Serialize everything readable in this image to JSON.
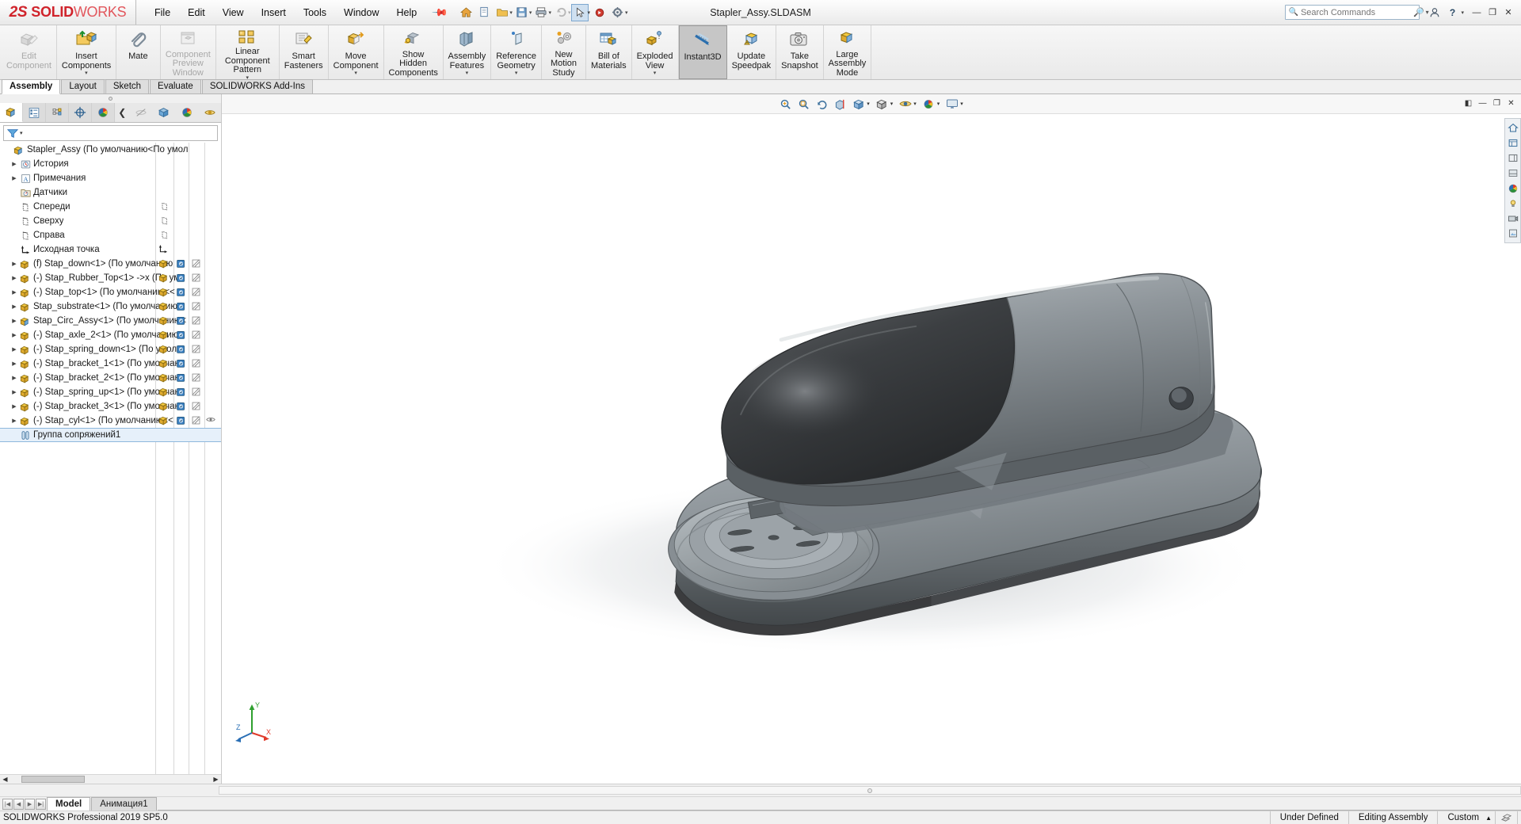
{
  "window": {
    "document_title": "Stapler_Assy.SLDASM",
    "logo_ds": "2S",
    "logo_solid": "SOLID",
    "logo_works": "WORKS"
  },
  "menu": {
    "items": [
      "File",
      "Edit",
      "View",
      "Insert",
      "Tools",
      "Window",
      "Help"
    ],
    "pin_icon": "pin-icon"
  },
  "title_toolbar": {
    "icons": [
      "home-icon",
      "new-doc-icon",
      "open-folder-icon",
      "save-icon",
      "print-icon",
      "undo-icon",
      "select-arrow-icon",
      "rebuild-icon",
      "options-gear-icon"
    ],
    "search": {
      "placeholder": "Search Commands",
      "value": ""
    },
    "user_icon": "user-icon",
    "help_icon": "help-icon",
    "minimize": "minimize-icon",
    "maximize": "maximize-icon",
    "close": "close-icon"
  },
  "ribbon": {
    "commands": [
      {
        "label": "Edit\nComponent",
        "icon": "edit-component-icon",
        "disabled": true,
        "caret": false,
        "active": false
      },
      {
        "label": "Insert\nComponents",
        "icon": "insert-components-icon",
        "disabled": false,
        "caret": true,
        "active": false
      },
      {
        "label": "Mate",
        "icon": "mate-paperclip-icon",
        "disabled": false,
        "caret": false,
        "active": false
      },
      {
        "label": "Component\nPreview\nWindow",
        "icon": "component-preview-icon",
        "disabled": true,
        "caret": false,
        "active": false
      },
      {
        "label": "Linear Component\nPattern",
        "icon": "linear-pattern-icon",
        "disabled": false,
        "caret": true,
        "active": false
      },
      {
        "label": "Smart\nFasteners",
        "icon": "smart-fasteners-icon",
        "disabled": false,
        "caret": false,
        "active": false
      },
      {
        "label": "Move\nComponent",
        "icon": "move-component-icon",
        "disabled": false,
        "caret": true,
        "active": false
      },
      {
        "label": "Show\nHidden\nComponents",
        "icon": "show-hidden-icon",
        "disabled": false,
        "caret": false,
        "active": false
      },
      {
        "label": "Assembly\nFeatures",
        "icon": "assembly-features-icon",
        "disabled": false,
        "caret": true,
        "active": false
      },
      {
        "label": "Reference\nGeometry",
        "icon": "reference-geometry-icon",
        "disabled": false,
        "caret": true,
        "active": false
      },
      {
        "label": "New\nMotion\nStudy",
        "icon": "new-motion-study-icon",
        "disabled": false,
        "caret": false,
        "active": false
      },
      {
        "label": "Bill of\nMaterials",
        "icon": "bill-of-materials-icon",
        "disabled": false,
        "caret": false,
        "active": false
      },
      {
        "label": "Exploded\nView",
        "icon": "exploded-view-icon",
        "disabled": false,
        "caret": true,
        "active": false
      },
      {
        "label": "Instant3D",
        "icon": "instant3d-icon",
        "disabled": false,
        "caret": false,
        "active": true
      },
      {
        "label": "Update\nSpeedpak",
        "icon": "update-speedpak-icon",
        "disabled": false,
        "caret": false,
        "active": false
      },
      {
        "label": "Take\nSnapshot",
        "icon": "take-snapshot-icon",
        "disabled": false,
        "caret": false,
        "active": false
      },
      {
        "label": "Large\nAssembly\nMode",
        "icon": "large-assembly-mode-icon",
        "disabled": false,
        "caret": false,
        "active": false
      }
    ]
  },
  "ribbon_tabs": {
    "items": [
      "Assembly",
      "Layout",
      "Sketch",
      "Evaluate",
      "SOLIDWORKS Add-Ins"
    ],
    "selected": "Assembly"
  },
  "feature_manager": {
    "tabs": [
      "feature-tree-icon",
      "property-manager-icon",
      "configuration-manager-icon",
      "dimxpert-icon",
      "display-manager-icon"
    ],
    "selected_index": 0,
    "collapse_icon": "chevron-left-icon",
    "extra_icons": [
      "hide-show-icon",
      "view-cube-icon",
      "appearance-sphere-icon",
      "display-pane-icon"
    ],
    "filter_placeholder": "",
    "filter_icon": "filter-funnel-icon",
    "tree": [
      {
        "label": "Stapler_Assy  (По умолчанию<По умол",
        "icon": "assembly-icon",
        "indent": 0,
        "expand": false,
        "root": true
      },
      {
        "label": "История",
        "icon": "history-icon",
        "indent": 1,
        "expand": true
      },
      {
        "label": "Примечания",
        "icon": "annotations-icon",
        "indent": 1,
        "expand": true
      },
      {
        "label": "Датчики",
        "icon": "sensors-icon",
        "indent": 1,
        "expand": false
      },
      {
        "label": "Спереди",
        "icon": "plane-icon",
        "indent": 1,
        "expand": false
      },
      {
        "label": "Сверху",
        "icon": "plane-icon",
        "indent": 1,
        "expand": false
      },
      {
        "label": "Справа",
        "icon": "plane-icon",
        "indent": 1,
        "expand": false
      },
      {
        "label": "Исходная точка",
        "icon": "origin-icon",
        "indent": 1,
        "expand": false
      },
      {
        "label": "(f) Stap_down<1> (По умолчанию",
        "icon": "part-icon",
        "indent": 1,
        "expand": true,
        "comp": true
      },
      {
        "label": "(-) Stap_Rubber_Top<1> ->x (По ум",
        "icon": "part-icon",
        "indent": 1,
        "expand": true,
        "comp": true
      },
      {
        "label": "(-) Stap_top<1> (По умолчанию<<",
        "icon": "part-icon",
        "indent": 1,
        "expand": true,
        "comp": true
      },
      {
        "label": "Stap_substrate<1> (По умолчанию<",
        "icon": "part-icon",
        "indent": 1,
        "expand": true,
        "comp": true
      },
      {
        "label": "Stap_Circ_Assy<1> (По умолчанию<",
        "icon": "subassembly-icon",
        "indent": 1,
        "expand": true,
        "comp": true
      },
      {
        "label": "(-) Stap_axle_2<1> (По умолчанию",
        "icon": "part-icon",
        "indent": 1,
        "expand": true,
        "comp": true
      },
      {
        "label": "(-) Stap_spring_down<1> (По умол",
        "icon": "part-icon",
        "indent": 1,
        "expand": true,
        "comp": true
      },
      {
        "label": "(-) Stap_bracket_1<1> (По умолчан",
        "icon": "part-icon",
        "indent": 1,
        "expand": true,
        "comp": true
      },
      {
        "label": "(-) Stap_bracket_2<1> (По умолчан",
        "icon": "part-icon",
        "indent": 1,
        "expand": true,
        "comp": true
      },
      {
        "label": "(-) Stap_spring_up<1> (По умолчан",
        "icon": "part-icon",
        "indent": 1,
        "expand": true,
        "comp": true
      },
      {
        "label": "(-) Stap_bracket_3<1> (По умолчан",
        "icon": "part-icon",
        "indent": 1,
        "expand": true,
        "comp": true
      },
      {
        "label": "(-) Stap_cyl<1> (По умолчанию<<",
        "icon": "part-icon",
        "indent": 1,
        "expand": true,
        "comp": true
      },
      {
        "label": "Группа сопряжений1",
        "icon": "mates-folder-icon",
        "indent": 1,
        "expand": false,
        "selected": true
      }
    ]
  },
  "view_toolbar": {
    "buttons": [
      "zoom-to-fit-icon",
      "zoom-to-area-icon",
      "previous-view-icon",
      "section-view-icon",
      "view-orientation-icon",
      "display-style-icon",
      "hide-show-items-icon",
      "edit-appearance-icon",
      "apply-scene-icon",
      "view-settings-icon"
    ],
    "window_buttons": [
      "restore-down-icon",
      "minimize-icon",
      "maximize-icon",
      "close-icon"
    ]
  },
  "right_toolbar": {
    "buttons": [
      "home-view-icon",
      "history-view-icon",
      "display-pane-icon",
      "appearance-icon",
      "scenes-icon",
      "lights-icon",
      "cameras-icon",
      "decals-icon"
    ]
  },
  "graphics": {
    "model_name": "Stapler assembly",
    "triad_labels": {
      "y": "Y",
      "x": "X",
      "z": "Z"
    }
  },
  "bottom_tabs": {
    "nav_buttons": [
      "first-icon",
      "prev-icon",
      "next-icon",
      "last-icon"
    ],
    "tabs": [
      "Model",
      "Анимация1"
    ],
    "selected": "Model"
  },
  "status_bar": {
    "left": "SOLIDWORKS Professional 2019 SP5.0",
    "under_defined": "Under Defined",
    "editing": "Editing Assembly",
    "units": "Custom",
    "units_caret": "▲",
    "right_icon": "overlay-icon"
  },
  "colors": {
    "brand_red": "#d0232b",
    "accent_blue": "#2a6fb5",
    "ribbon_bg": "#f0f0f0",
    "active_cmd": "#c6c6c6",
    "model_body": "#8e9499",
    "model_dark": "#3a3d40"
  }
}
